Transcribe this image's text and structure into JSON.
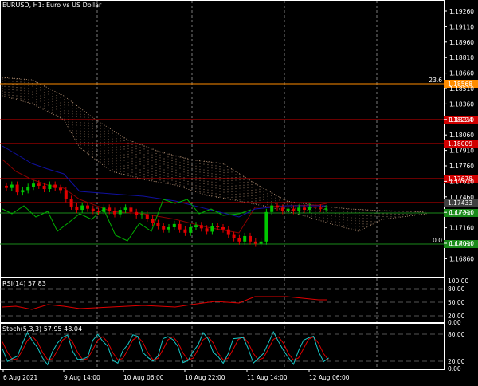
{
  "header": {
    "symbol": "EURUSD",
    "timeframe": "H1",
    "description": "Euro vs US Dollar",
    "title_text": "EURUSD, H1:  Euro vs US Dollar"
  },
  "price_axis": {
    "labels": [
      "1.19260",
      "1.19110",
      "1.18960",
      "1.18810",
      "1.18660",
      "1.18510",
      "1.18360",
      "1.18210",
      "1.18060",
      "1.17910",
      "1.17760",
      "1.17610",
      "1.17460",
      "1.17310",
      "1.17160",
      "1.17010",
      "1.16860"
    ]
  },
  "fib_levels": [
    {
      "label": "23.6",
      "price_tag": "1.18568",
      "color": "#ff8c00"
    },
    {
      "label": "",
      "price_tag": "1.18224",
      "color": "#d00000"
    },
    {
      "label": "",
      "price_tag": "1.18009",
      "color": "#d00000"
    },
    {
      "label": "",
      "price_tag": "1.17678",
      "color": "#d00000"
    },
    {
      "label": "",
      "price_tag": "1.17430",
      "color": "#d00000"
    },
    {
      "label": "",
      "price_tag": "1.17350",
      "color": "#1a8a1a"
    },
    {
      "label": "0.0",
      "price_tag": "1.17060",
      "color": "#1a8a1a"
    }
  ],
  "current_price": {
    "tag": "1.17433",
    "color": "#404040"
  },
  "rsi": {
    "title": "RSI(14) 57.83",
    "labels": [
      "100.00",
      "80.00",
      "50.00",
      "20.00",
      "0.00"
    ]
  },
  "stoch": {
    "title": "Stoch(5,3,3) 57.95 48.04",
    "labels": [
      "80.00",
      "20.00",
      "0.00"
    ]
  },
  "time_axis": {
    "labels": [
      "6 Aug 2021",
      "9 Aug 14:00",
      "10 Aug 06:00",
      "10 Aug 22:00",
      "11 Aug 14:00",
      "12 Aug 06:00"
    ]
  },
  "colors": {
    "bull": "#00c800",
    "bear": "#e00000",
    "kijun": "#8b0000",
    "tenkun": "#1010a0",
    "chikou": "#00b000",
    "cloud": "#c8a080",
    "rsi_line": "#e00000",
    "stoch_main": "#18c8c8",
    "stoch_signal": "#e00000",
    "grid": "#ffffff"
  },
  "chart_data": {
    "type": "candlestick",
    "symbol": "EURUSD",
    "timeframe": "H1",
    "close_series_approx": [
      1.1762,
      1.1765,
      1.1758,
      1.176,
      1.1763,
      1.1766,
      1.1764,
      1.1761,
      1.1765,
      1.1762,
      1.176,
      1.1752,
      1.1745,
      1.1742,
      1.1746,
      1.1743,
      1.1741,
      1.174,
      1.1744,
      1.1741,
      1.1738,
      1.1742,
      1.1744,
      1.174,
      1.1737,
      1.1738,
      1.1734,
      1.173,
      1.1727,
      1.1724,
      1.1726,
      1.1729,
      1.1724,
      1.1721,
      1.1726,
      1.1728,
      1.1725,
      1.1722,
      1.1727,
      1.1726,
      1.1724,
      1.1719,
      1.1716,
      1.1713,
      1.1718,
      1.1713,
      1.1711,
      1.1713,
      1.174,
      1.1746,
      1.1744,
      1.1741,
      1.1743,
      1.1741,
      1.1744,
      1.1742,
      1.1745,
      1.1744,
      1.1743,
      1.17433
    ],
    "ylim": [
      1.168,
      1.1934
    ]
  }
}
